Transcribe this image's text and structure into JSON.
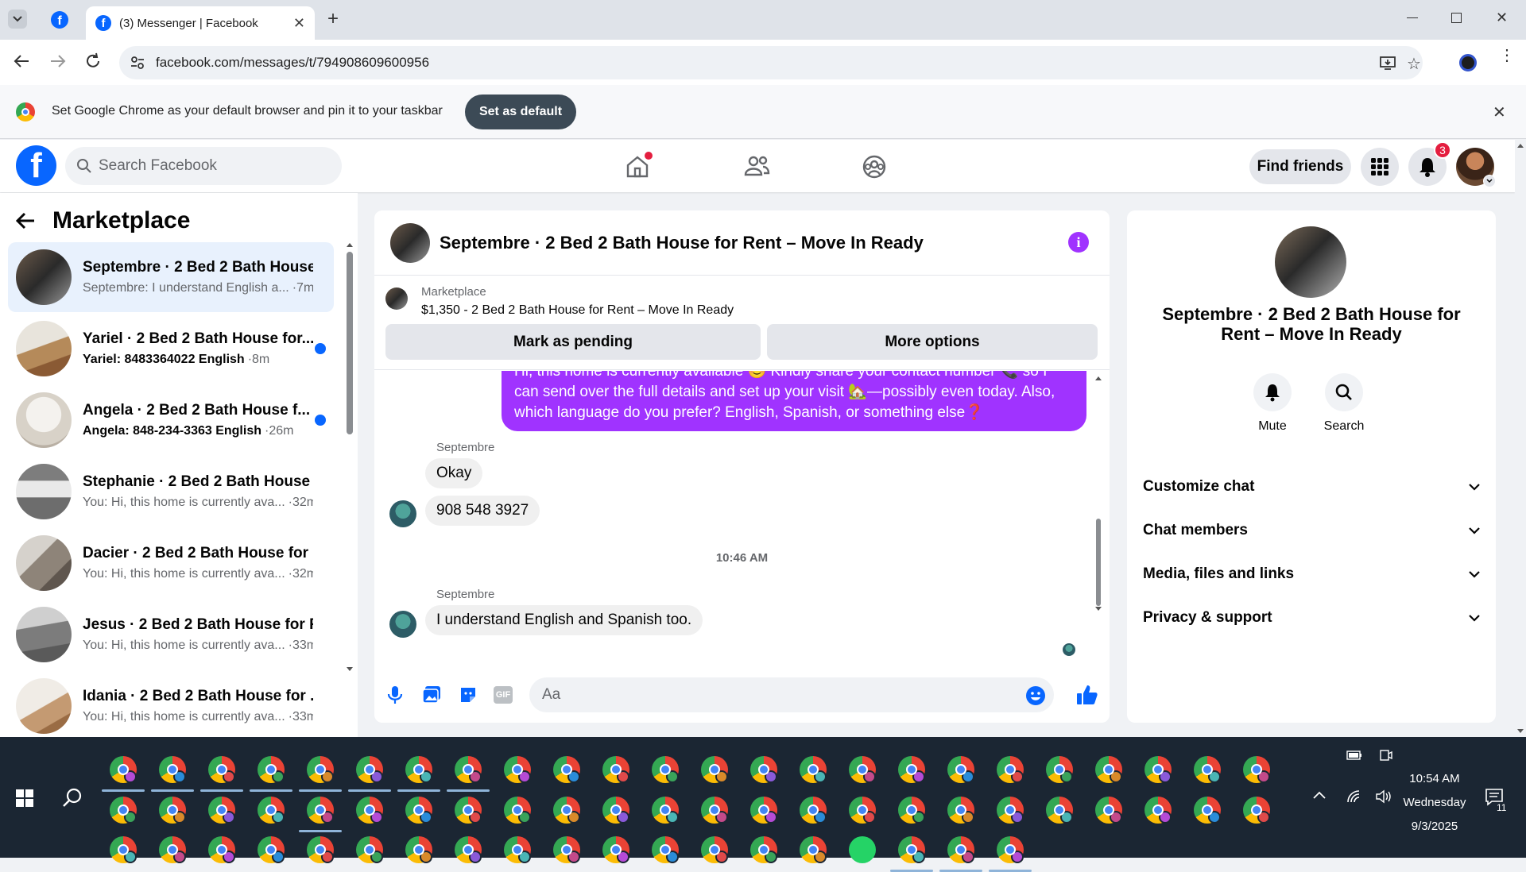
{
  "browser": {
    "tab_title": "(3) Messenger | Facebook",
    "url": "facebook.com/messages/t/794908609600956",
    "infobar_text": "Set Google Chrome as your default browser and pin it to your taskbar",
    "infobar_button": "Set as default"
  },
  "header": {
    "search_placeholder": "Search Facebook",
    "find_friends": "Find friends",
    "notification_count": "3"
  },
  "left": {
    "title": "Marketplace",
    "conversations": [
      {
        "title": "Septembre · 2 Bed 2 Bath House...",
        "preview": "Septembre: I understand English a...",
        "time": "·7m",
        "unread": false,
        "active": true
      },
      {
        "title": "Yariel · 2 Bed 2 Bath House for...",
        "preview": "Yariel: 8483364022 English",
        "time": "·8m",
        "unread": true,
        "active": false
      },
      {
        "title": "Angela · 2 Bed 2 Bath House f...",
        "preview": "Angela: 848-234-3363 English",
        "time": "·26m",
        "unread": true,
        "active": false
      },
      {
        "title": "Stephanie · 2 Bed 2 Bath House ...",
        "preview": "You: Hi, this home is currently ava...",
        "time": "·32m",
        "unread": false,
        "active": false
      },
      {
        "title": "Dacier · 2 Bed 2 Bath House for ...",
        "preview": "You: Hi, this home is currently ava...",
        "time": "·32m",
        "unread": false,
        "active": false
      },
      {
        "title": "Jesus · 2 Bed 2 Bath House for R...",
        "preview": "You: Hi, this home is currently ava...",
        "time": "·33m",
        "unread": false,
        "active": false
      },
      {
        "title": "Idania · 2 Bed 2 Bath House for ...",
        "preview": "You: Hi, this home is currently ava...",
        "time": "·33m",
        "unread": false,
        "active": false
      }
    ]
  },
  "chat": {
    "title": "Septembre · 2 Bed 2 Bath House for Rent – Move In Ready",
    "marketplace_label": "Marketplace",
    "listing": "$1,350 - 2 Bed 2 Bath House for Rent – Move In Ready",
    "mark_pending": "Mark as pending",
    "more_options": "More options",
    "outgoing_message": "Hi, this home is currently available 😊 Kindly share your contact number 📞 so I can send over the full details and set up your visit 🏡—possibly even today. Also, which language do you prefer? English, Spanish, or something else❓",
    "sender_1": "Septembre",
    "msg_okay": "Okay",
    "msg_phone": "908 548 3927",
    "timestamp": "10:46 AM",
    "sender_2": "Septembre",
    "msg_language": "I understand English and Spanish too.",
    "composer_placeholder": "Aa"
  },
  "right": {
    "name": "Septembre · 2 Bed 2 Bath House for Rent – Move In Ready",
    "mute": "Mute",
    "search": "Search",
    "sections": [
      "Customize chat",
      "Chat members",
      "Media, files and links",
      "Privacy & support"
    ]
  },
  "taskbar": {
    "time": "10:54 AM",
    "day": "Wednesday",
    "date": "9/3/2025",
    "notification_count": "11"
  },
  "colors": {
    "facebook_blue": "#0866ff",
    "messenger_purple": "#a033ff",
    "taskbar": "#1b2633"
  }
}
